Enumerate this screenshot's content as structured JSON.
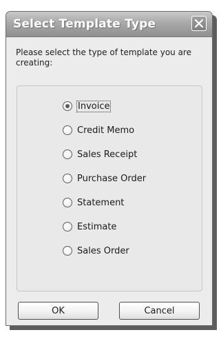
{
  "dialog": {
    "title": "Select Template Type",
    "prompt": "Please select the type of template you are creating:",
    "options": [
      {
        "label": "Invoice",
        "selected": true
      },
      {
        "label": "Credit Memo",
        "selected": false
      },
      {
        "label": "Sales Receipt",
        "selected": false
      },
      {
        "label": "Purchase Order",
        "selected": false
      },
      {
        "label": "Statement",
        "selected": false
      },
      {
        "label": "Estimate",
        "selected": false
      },
      {
        "label": "Sales Order",
        "selected": false
      }
    ],
    "ok_label": "OK",
    "cancel_label": "Cancel"
  }
}
